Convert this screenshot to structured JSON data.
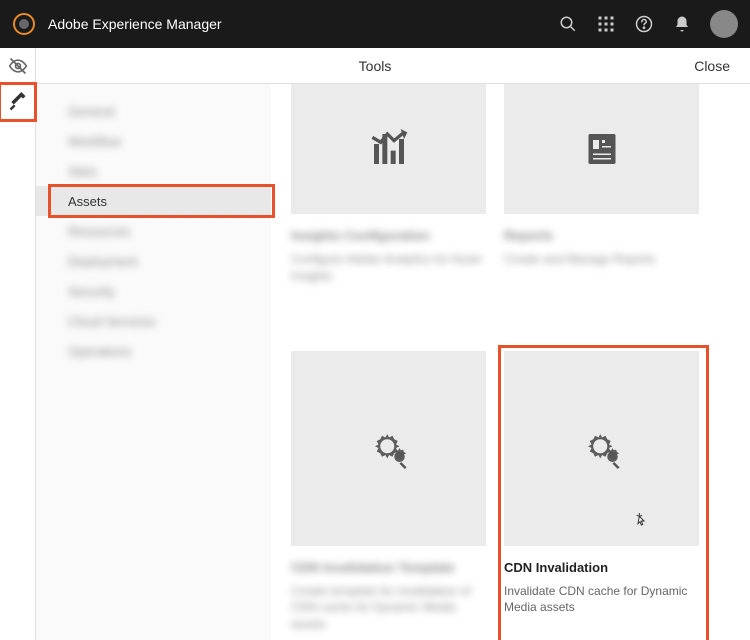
{
  "header": {
    "brand": "Adobe Experience Manager"
  },
  "toolbar": {
    "title": "Tools",
    "close": "Close"
  },
  "nav": {
    "items": [
      {
        "label": "General",
        "blurred": true
      },
      {
        "label": "Workflow",
        "blurred": true
      },
      {
        "label": "Sites",
        "blurred": true
      },
      {
        "label": "Assets",
        "blurred": false,
        "selected": true,
        "highlighted": true
      },
      {
        "label": "Resources",
        "blurred": true
      },
      {
        "label": "Deployment",
        "blurred": true
      },
      {
        "label": "Security",
        "blurred": true
      },
      {
        "label": "Cloud Services",
        "blurred": true
      },
      {
        "label": "Operations",
        "blurred": true
      }
    ]
  },
  "cards": {
    "row1": [
      {
        "title": "Insights Configuration",
        "desc": "Configure Adobe Analytics for Asset Insights",
        "icon": "chart-trend",
        "blurred": true
      },
      {
        "title": "Reports",
        "desc": "Create and Manage Reports",
        "icon": "report",
        "blurred": true
      }
    ],
    "row2": [
      {
        "title": "CDN Invalidation Template",
        "desc": "Create template for invalidation of CDN cache for Dynamic Media assets",
        "icon": "gears",
        "blurred": true
      },
      {
        "title": "CDN Invalidation",
        "desc": "Invalidate CDN cache for Dynamic Media assets",
        "icon": "gears",
        "blurred": false,
        "highlighted": true
      }
    ]
  },
  "colors": {
    "highlight": "#e8522b",
    "tile_bg": "#ebebeb"
  }
}
